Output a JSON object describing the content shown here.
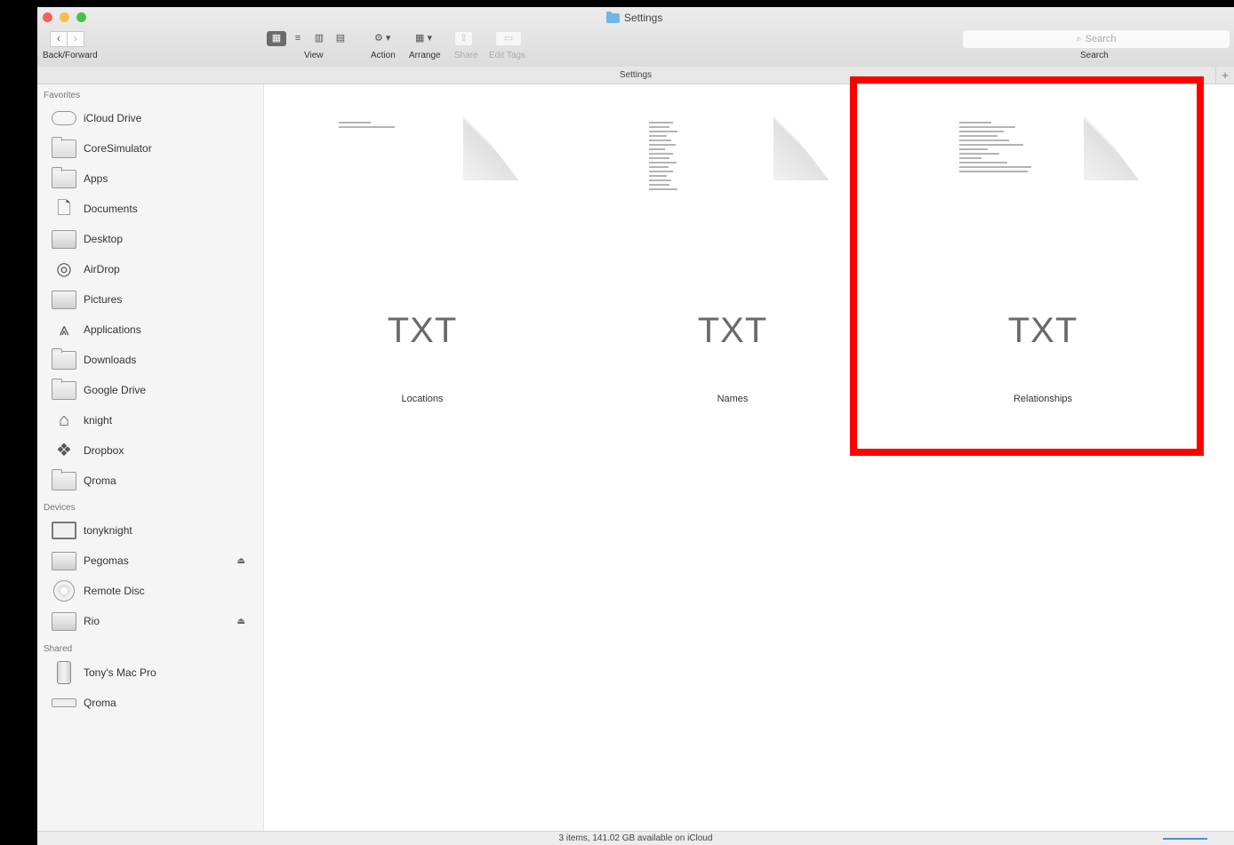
{
  "window": {
    "title": "Settings"
  },
  "toolbar": {
    "back_forward_label": "Back/Forward",
    "view_label": "View",
    "action_label": "Action",
    "arrange_label": "Arrange",
    "share_label": "Share",
    "edit_tags_label": "Edit Tags",
    "search_placeholder": "Search",
    "search_label": "Search"
  },
  "pathbar": {
    "title": "Settings"
  },
  "sidebar": {
    "favorites_header": "Favorites",
    "favorites": [
      {
        "label": "iCloud Drive",
        "icon": "cloud-icon"
      },
      {
        "label": "CoreSimulator",
        "icon": "folder-icon"
      },
      {
        "label": "Apps",
        "icon": "folder-icon"
      },
      {
        "label": "Documents",
        "icon": "documents-icon"
      },
      {
        "label": "Desktop",
        "icon": "desktop-icon"
      },
      {
        "label": "AirDrop",
        "icon": "airdrop-icon"
      },
      {
        "label": "Pictures",
        "icon": "camera-icon"
      },
      {
        "label": "Applications",
        "icon": "applications-icon"
      },
      {
        "label": "Downloads",
        "icon": "folder-icon"
      },
      {
        "label": "Google Drive",
        "icon": "folder-icon"
      },
      {
        "label": "knight",
        "icon": "home-icon"
      },
      {
        "label": "Dropbox",
        "icon": "dropbox-icon"
      },
      {
        "label": "Qroma",
        "icon": "folder-icon"
      }
    ],
    "devices_header": "Devices",
    "devices": [
      {
        "label": "tonyknight",
        "icon": "laptop-icon"
      },
      {
        "label": "Pegomas",
        "icon": "disk-icon",
        "eject": "⏏"
      },
      {
        "label": "Remote Disc",
        "icon": "disc-icon"
      },
      {
        "label": "Rio",
        "icon": "disk-icon",
        "eject": "⏏"
      }
    ],
    "shared_header": "Shared",
    "shared": [
      {
        "label": "Tony's Mac Pro",
        "icon": "mac-pro-icon"
      },
      {
        "label": "Qroma",
        "icon": "network-computer-icon"
      }
    ]
  },
  "files": [
    {
      "name": "Locations",
      "ext": "TXT"
    },
    {
      "name": "Names",
      "ext": "TXT"
    },
    {
      "name": "Relationships",
      "ext": "TXT",
      "highlighted": true
    }
  ],
  "highlight_color": "#ff0000",
  "statusbar": {
    "text": "3 items, 141.02 GB available on iCloud"
  }
}
